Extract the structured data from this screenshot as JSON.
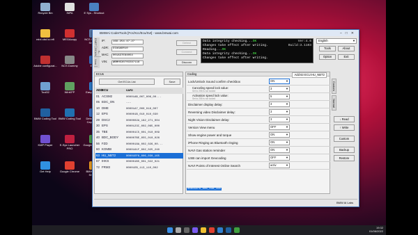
{
  "desktop": {
    "icons": [
      {
        "label": "Recycle Bin",
        "color": "#8fb0d0"
      },
      {
        "label": "INPA",
        "color": "#e0e0e0"
      },
      {
        "label": "E Sys - Shortcut",
        "color": "#4a80c0"
      },
      {
        "label": "mini obd ko efi",
        "color": "#f0c040"
      },
      {
        "label": "MEGAcopy",
        "color": "#d03030"
      },
      {
        "label": "NCS Services - Shortcut",
        "color": "#6080b0"
      },
      {
        "label": "Adobe configurat...",
        "color": "#c03030"
      },
      {
        "label": "NCS Dummy",
        "color": "#888888"
      },
      {
        "label": "E-Sys",
        "color": "#3a70c0"
      },
      {
        "label": "Tool32",
        "color": "#70a0d0"
      },
      {
        "label": "WinKFP",
        "color": "#60a060"
      },
      {
        "label": "EasyConnect",
        "color": "#3080d0"
      },
      {
        "label": "BMW Coding Tool",
        "color": "#2060a0"
      },
      {
        "label": "BMW Coding Tool",
        "color": "#2070b0"
      },
      {
        "label": "Detroit Video Capture SE",
        "color": "#4070c0"
      },
      {
        "label": "KMP Player",
        "color": "#7050d0"
      },
      {
        "label": "E-Sys Launcher PRO",
        "color": "#c02040"
      },
      {
        "label": "Google Earth Pro",
        "color": "#50a050"
      },
      {
        "label": "Get Help",
        "color": "#3090e0"
      },
      {
        "label": "Google Chrome",
        "color": "#e04030"
      },
      {
        "label": "BMWCoder - Shortcut",
        "color": "#f0a020"
      }
    ]
  },
  "window": {
    "title": "BMWAi CoderTools [Fcs/Xcc/Ecu/Svt] - www.bmwai.com",
    "side_tabs": [
      "ENET",
      "K-DCAN",
      "Vcm"
    ],
    "ip_label": "IP:",
    "ip_value": "169.254.47.27",
    "adr_label": "ADR:",
    "adr_value": "DIAGADR10",
    "mac_label": "MAC:",
    "mac_value": "001A37E84054",
    "vin_label": "VIN:",
    "vin_value": "WBMH53070CE87116",
    "detect_btn": "Detect",
    "connect_btn": "Connect",
    "disconnect_btn": "Disconn",
    "log": [
      {
        "text": "Data integrity checking...",
        "ok": "OK",
        "right": "Ver:4.6"
      },
      {
        "text": "Changes take effect after writing.",
        "ok": "",
        "right": "Build:3.1103"
      },
      {
        "text": "Reading...",
        "ok": "OK",
        "right": ""
      },
      {
        "text": "Data integrity checking...",
        "ok": "OK",
        "right": ""
      },
      {
        "text": "Changes take effect after writing.",
        "ok": "",
        "right": ""
      }
    ],
    "language": "English",
    "tools_btn": "Tools",
    "about_btn": "About",
    "option_btn": "Option",
    "exit_btn": "Exit",
    "ecus_panel_label": "ECUs",
    "get_ecus_btn": "Get ECUs List",
    "save_btn": "Save",
    "ecu_columns": [
      "ADD",
      "ECU",
      "CAFD"
    ],
    "ecu_rows": [
      {
        "add": "01",
        "ecu": "ACSM2",
        "cafd": "00001AB_007_006_00..."
      },
      {
        "add": "05",
        "ecu": "EDC_ON",
        "cafd": "---"
      },
      {
        "add": "10",
        "ecu": "DME",
        "cafd": "00001A7_000_018_007"
      },
      {
        "add": "12",
        "ecu": "EPS",
        "cafd": "000001B_010_010_030"
      },
      {
        "add": "29",
        "ecu": "DSC2",
        "cafd": "0000002A_182_271_004"
      },
      {
        "add": "30",
        "ecu": "EPS",
        "cafd": "0000123C_002_065_000"
      },
      {
        "add": "35",
        "ecu": "TBE",
        "cafd": "000001C5_001_010_009"
      },
      {
        "add": "40",
        "ecu": "BDC_BODY",
        "cafd": "000007BE_055_010_026"
      },
      {
        "add": "56",
        "ecu": "FZD",
        "cafd": "0000018A_002_026_00..."
      },
      {
        "add": "60",
        "ecu": "KOMBI",
        "cafd": "0000161F_002_025_240"
      },
      {
        "add": "63",
        "ecu": "HU_NBT2",
        "cafd": "00001EF6_006_030_165"
      },
      {
        "add": "67",
        "ecu": "IHKS",
        "cafd": "000001B5_001_022_021"
      },
      {
        "add": "72",
        "ecu": "FRM3",
        "cafd": "00001EB_113_110_002"
      }
    ],
    "selected_ecu_index": 10,
    "coding_panel_label": "Coding",
    "coding_addr": "Add:63 ECU:HU_NBT2",
    "coding_rows": [
      {
        "label": "Lock/Unlock Sound confirm checkbox",
        "value": "ON",
        "sub": false,
        "highlight": true
      },
      {
        "label": "Canceling speed lock value:",
        "note": "Set to 255 is not locked",
        "value": "3",
        "sub": true
      },
      {
        "label": "Activation speed lock value:",
        "note": "Set to 255 is not locked",
        "value": "5",
        "sub": true
      },
      {
        "label": "Disclaimer display delay:",
        "value": "3",
        "sub": false
      },
      {
        "label": "Reversing video Disclaimer delay:",
        "value": "3",
        "sub": false
      },
      {
        "label": "Night Vision Disclaimer delay:",
        "value": "3",
        "sub": false
      },
      {
        "label": "Version View menu",
        "value": "OFF",
        "sub": false
      },
      {
        "label": "Show engine power and torque",
        "value": "ON",
        "sub": false
      },
      {
        "label": "iPhone Ringing as Bluetooth ringing",
        "value": "ON",
        "sub": false
      },
      {
        "label": "NAVI Gas station reminder",
        "value": "ON",
        "sub": false
      },
      {
        "label": "USB can import Geocoding",
        "value": "OFF",
        "sub": false
      },
      {
        "label": "NAVI Points of Interest Online Search",
        "value": "activ",
        "sub": false
      }
    ],
    "coding_footer": "00001EF6_006_030_165",
    "coding_tabs": [
      "Custom",
      "Normal"
    ],
    "read_btn": "Read",
    "write_btn": "Write",
    "custom_btn": "Custom",
    "backup_btn": "Backup",
    "restore_btn": "Restore",
    "status_right": "BMW Ai Labs"
  },
  "taskbar": {
    "time": "19:32",
    "date": "01/06/2022"
  }
}
